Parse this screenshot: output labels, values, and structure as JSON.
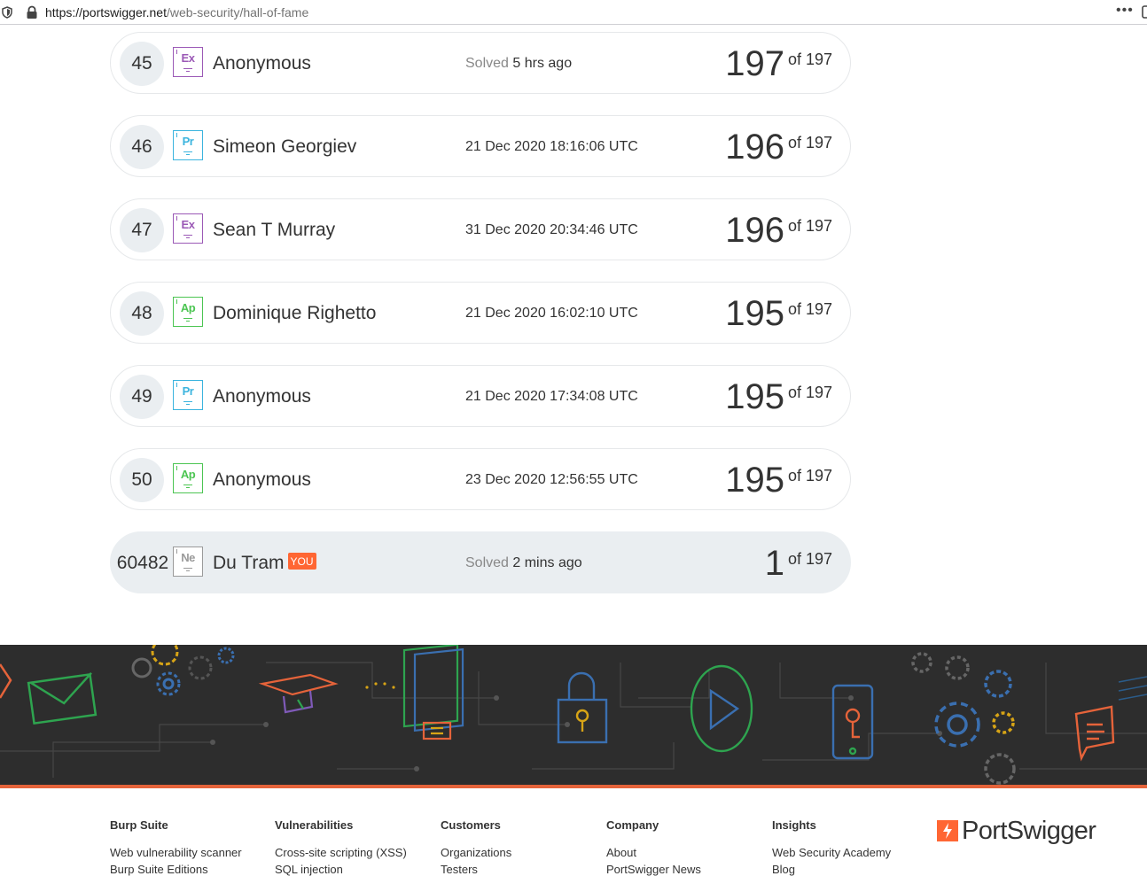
{
  "browser": {
    "url_host": "https://portswigger.net",
    "url_path": "/web-security/hall-of-fame",
    "menu_glyph": "•••"
  },
  "leaderboard": {
    "rows": [
      {
        "rank": "45",
        "badge": "Ex",
        "badge_color": "#9b59b6",
        "name": "Anonymous",
        "when_label": "Solved",
        "when": "5 hrs ago",
        "score": "197",
        "of": "of 197"
      },
      {
        "rank": "46",
        "badge": "Pr",
        "badge_color": "#3bb4de",
        "name": "Simeon Georgiev",
        "when_label": "",
        "when": "21 Dec 2020 18:16:06 UTC",
        "score": "196",
        "of": "of 197"
      },
      {
        "rank": "47",
        "badge": "Ex",
        "badge_color": "#9b59b6",
        "name": "Sean T Murray",
        "when_label": "",
        "when": "31 Dec 2020 20:34:46 UTC",
        "score": "196",
        "of": "of 197"
      },
      {
        "rank": "48",
        "badge": "Ap",
        "badge_color": "#4cc552",
        "name": "Dominique Righetto",
        "when_label": "",
        "when": "21 Dec 2020 16:02:10 UTC",
        "score": "195",
        "of": "of 197"
      },
      {
        "rank": "49",
        "badge": "Pr",
        "badge_color": "#3bb4de",
        "name": "Anonymous",
        "when_label": "",
        "when": "21 Dec 2020 17:34:08 UTC",
        "score": "195",
        "of": "of 197"
      },
      {
        "rank": "50",
        "badge": "Ap",
        "badge_color": "#4cc552",
        "name": "Anonymous",
        "when_label": "",
        "when": "23 Dec 2020 12:56:55 UTC",
        "score": "195",
        "of": "of 197"
      }
    ],
    "me": {
      "rank": "60482",
      "badge": "Ne",
      "badge_color": "#9a9a9a",
      "name": "Du Tram",
      "you_tag": "YOU",
      "when_label": "Solved",
      "when": "2 mins ago",
      "score": "1",
      "of": "of 197"
    }
  },
  "footer": {
    "columns": [
      {
        "heading": "Burp Suite",
        "links": [
          "Web vulnerability scanner",
          "Burp Suite Editions"
        ]
      },
      {
        "heading": "Vulnerabilities",
        "links": [
          "Cross-site scripting (XSS)",
          "SQL injection"
        ]
      },
      {
        "heading": "Customers",
        "links": [
          "Organizations",
          "Testers"
        ]
      },
      {
        "heading": "Company",
        "links": [
          "About",
          "PortSwigger News"
        ]
      },
      {
        "heading": "Insights",
        "links": [
          "Web Security Academy",
          "Blog"
        ]
      }
    ],
    "brand": "PortSwigger",
    "accent": "#ff6633"
  }
}
